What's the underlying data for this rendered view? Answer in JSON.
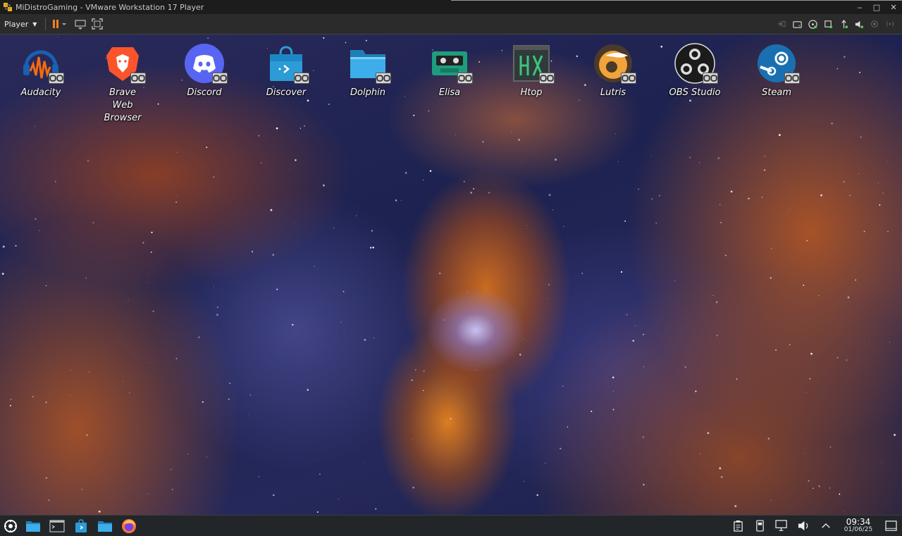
{
  "window": {
    "title": "MiDistroGaming - VMware Workstation 17 Player",
    "controls": [
      "minimize-icon",
      "maximize-icon",
      "close-icon"
    ]
  },
  "toolbar": {
    "player_label": "Player",
    "buttons": [
      "pause-icon",
      "send-ctrl-alt-del-icon",
      "fullscreen-icon"
    ],
    "device_icons": [
      "network-adapter-icon",
      "hard-disk-icon",
      "cd-dvd-icon",
      "usb-icon",
      "usb-device-icon",
      "sound-card-icon",
      "camera-icon",
      "wireless-icon"
    ]
  },
  "desktop": {
    "icons": [
      {
        "label": "Audacity",
        "icon": "audacity-icon"
      },
      {
        "label": "Brave Web Browser",
        "icon": "brave-icon"
      },
      {
        "label": "Discord",
        "icon": "discord-icon"
      },
      {
        "label": "Discover",
        "icon": "discover-icon"
      },
      {
        "label": "Dolphin",
        "icon": "dolphin-icon"
      },
      {
        "label": "Elisa",
        "icon": "elisa-icon"
      },
      {
        "label": "Htop",
        "icon": "htop-icon"
      },
      {
        "label": "Lutris",
        "icon": "lutris-icon"
      },
      {
        "label": "OBS Studio",
        "icon": "obs-icon"
      },
      {
        "label": "Steam",
        "icon": "steam-icon"
      }
    ]
  },
  "taskbar": {
    "launchers": [
      "application-launcher-icon",
      "file-manager-icon",
      "terminal-icon",
      "discover-store-icon",
      "dolphin-folder-icon",
      "firefox-icon"
    ],
    "tray": [
      "clipboard-icon",
      "storage-device-icon",
      "network-icon",
      "volume-icon",
      "tray-expand-icon"
    ],
    "time": "09:34",
    "date": "01/06/25"
  }
}
